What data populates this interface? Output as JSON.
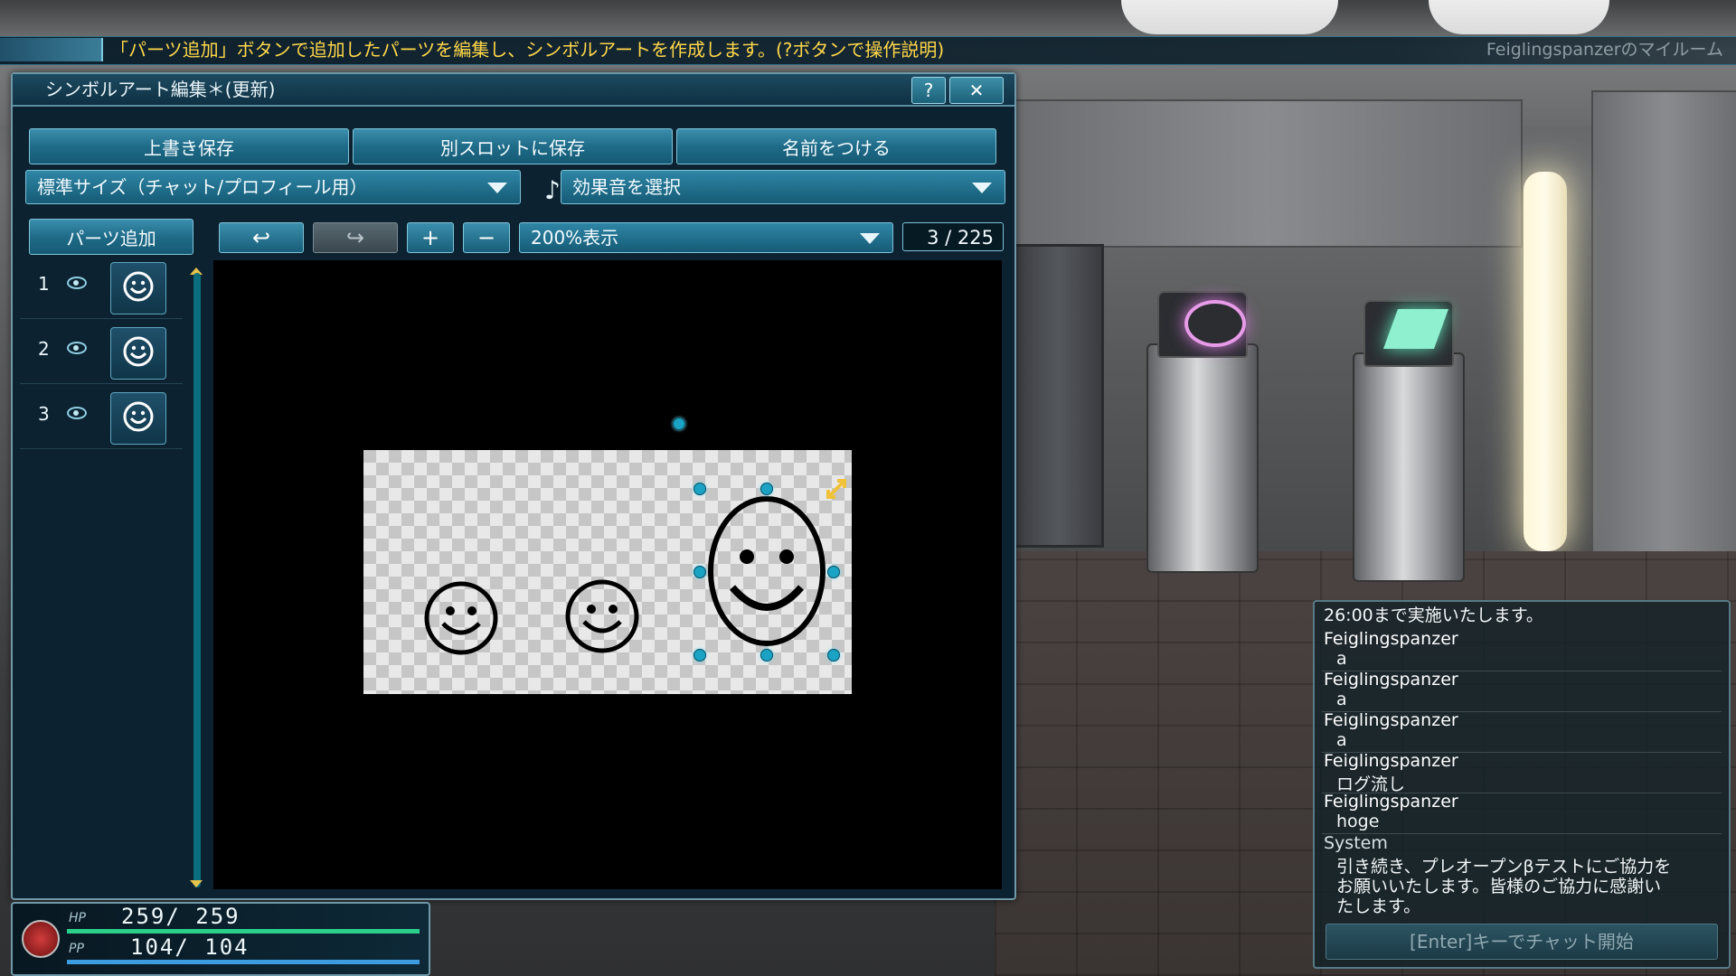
{
  "info_bar": {
    "message": "「パーツ追加」ボタンで追加したパーツを編集し、シンボルアートを作成します。(?ボタンで操作説明)",
    "room_title": "Feiglingspanzerのマイルーム"
  },
  "editor": {
    "title": "シンボルアート編集＊(更新)",
    "help_label": "?",
    "close_label": "✕",
    "buttons": {
      "overwrite_save": "上書き保存",
      "save_other_slot": "別スロットに保存",
      "name_it": "名前をつける",
      "add_parts": "パーツ追加",
      "undo": "↩",
      "redo": "↪",
      "zoom_in": "+",
      "zoom_out": "−"
    },
    "size_select": "標準サイズ（チャット/プロフィール用）",
    "sound_select": "効果音を選択",
    "zoom_select": "200%表示",
    "part_count": "3 / 225",
    "parts": [
      {
        "number": "1",
        "icon": "smiley-icon"
      },
      {
        "number": "2",
        "icon": "smiley-icon"
      },
      {
        "number": "3",
        "icon": "smiley-icon"
      }
    ]
  },
  "stats": {
    "hp_label": "HP",
    "hp_value": "259/ 259",
    "pp_label": "PP",
    "pp_value": "104/ 104"
  },
  "chat": {
    "lines": [
      {
        "type": "msg",
        "text": "26:00まで実施いたします。"
      },
      {
        "type": "name",
        "text": "Feiglingspanzer"
      },
      {
        "type": "msg",
        "text": "a"
      },
      {
        "type": "name",
        "text": "Feiglingspanzer"
      },
      {
        "type": "msg",
        "text": "a"
      },
      {
        "type": "name",
        "text": "Feiglingspanzer"
      },
      {
        "type": "msg",
        "text": "a"
      },
      {
        "type": "name",
        "text": "Feiglingspanzer"
      },
      {
        "type": "msg",
        "text": "ログ流し"
      },
      {
        "type": "name",
        "text": "Feiglingspanzer"
      },
      {
        "type": "msg",
        "text": "hoge"
      },
      {
        "type": "sys",
        "text": "System"
      },
      {
        "type": "msg",
        "text": "引き続き、プレオープンβテストにご協力を"
      },
      {
        "type": "msg",
        "text": "お願いいたします。皆様のご協力に感謝い"
      },
      {
        "type": "msg",
        "text": "たします。"
      }
    ],
    "input_placeholder": "[Enter]キーでチャット開始"
  },
  "colors": {
    "accent": "#1f6b88",
    "info_text": "#ffd84a",
    "hp_bar": "#2ad08a",
    "pp_bar": "#3d9be0"
  }
}
